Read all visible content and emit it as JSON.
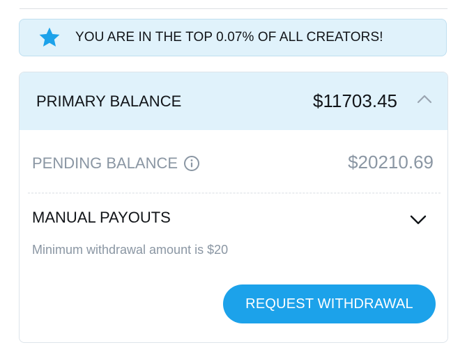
{
  "banner": {
    "text": "YOU ARE IN THE TOP 0.07% OF ALL CREATORS!",
    "icon": "star-icon",
    "icon_color": "#1ca2ea"
  },
  "balances": {
    "primary": {
      "label": "PRIMARY BALANCE",
      "amount": "$11703.45",
      "state": "expanded"
    },
    "pending": {
      "label": "PENDING BALANCE",
      "amount": "$20210.69",
      "info_icon": "info-icon"
    }
  },
  "payouts": {
    "label": "MANUAL PAYOUTS",
    "state": "collapsed",
    "min_note": "Minimum withdrawal amount is $20",
    "button_label": "REQUEST WITHDRAWAL"
  },
  "colors": {
    "accent": "#1ca2ea",
    "banner_bg": "#e0f2fb",
    "muted_text": "#8a96a3",
    "text": "#111418"
  }
}
